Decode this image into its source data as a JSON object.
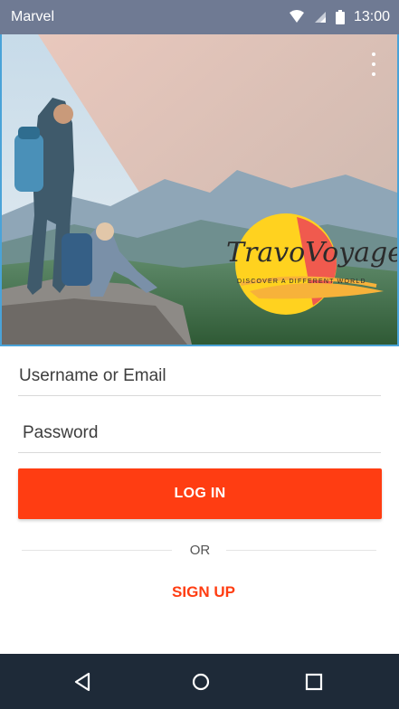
{
  "status_bar": {
    "carrier": "Marvel",
    "time": "13:00",
    "icons": [
      "wifi-icon",
      "cell-signal-icon",
      "battery-icon"
    ]
  },
  "hero": {
    "menu_icon": "overflow-menu-icon",
    "logo": {
      "title": "TravoVoyage",
      "tagline": "DISCOVER A DIFFERENT WORLD"
    }
  },
  "form": {
    "username_placeholder": "Username or Email",
    "password_placeholder": "Password",
    "login_label": "LOG IN",
    "or_label": "OR",
    "signup_label": "SIGN UP"
  },
  "navigation_bar": {
    "icons": [
      "back-icon",
      "home-icon",
      "recents-icon"
    ]
  },
  "colors": {
    "accent": "#ff3d12",
    "status_bar": "#6f7a93",
    "nav_bar": "#1e2a38",
    "hero_border": "#4aa3d8"
  }
}
